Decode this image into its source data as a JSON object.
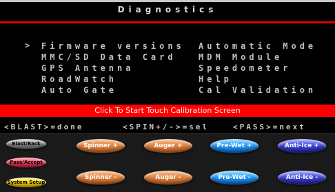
{
  "header": {
    "title": "Diagnostics"
  },
  "menu": {
    "cursor": ">",
    "left": [
      "Firmware versions",
      "MMC/SD Data Card",
      "GPS Antenna",
      "RoadWatch",
      "Auto Gate"
    ],
    "right": [
      "Automatic Mode",
      "MDM Module",
      "Speedometer",
      "Help",
      "Cal Validation"
    ]
  },
  "calibration_bar": {
    "label": "Click To Start Touch Calibration Screen"
  },
  "commands": {
    "blast": "<BLAST>=done",
    "spin": "<SPIN+/->=sel",
    "pass": "<PASS>=next"
  },
  "buttons": {
    "blast_back": "Blast/Back",
    "pass_accept": "Pass/Accept",
    "system_setup": "System Setup",
    "spinner_plus": "Spinner +",
    "spinner_minus": "Spinner -",
    "auger_plus": "Auger +",
    "auger_minus": "Auger -",
    "prewet_plus": "Pre-Wet +",
    "prewet_minus": "Pre-Wet -",
    "antiice_plus": "Anti-Ice +",
    "antiice_minus": "Anti-Ice -"
  },
  "colors": {
    "accent_red": "#ff0000",
    "gray": "#8a8a8a",
    "pink": "#f0405e",
    "yellow": "#f5d200",
    "orange": "#d97b3a",
    "cyan": "#1f90f0",
    "navy": "#3a3fcf"
  }
}
